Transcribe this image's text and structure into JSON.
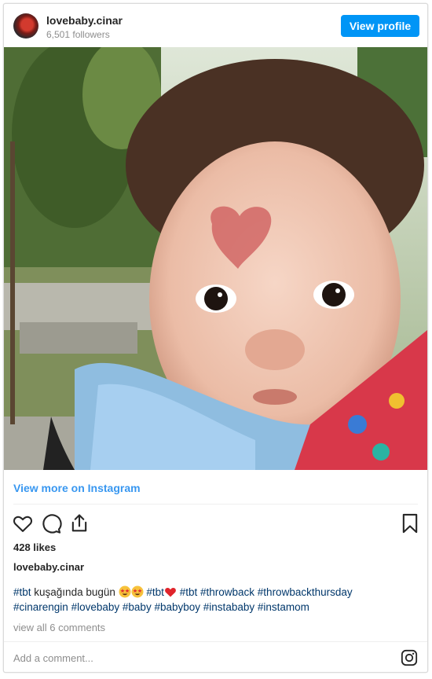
{
  "header": {
    "username": "lovebaby.cinar",
    "followers": "6,501 followers",
    "view_profile_label": "View profile"
  },
  "post": {
    "view_more_label": "View more on Instagram",
    "likes": "428 likes",
    "author": "lovebaby.cinar",
    "caption": {
      "line1_parts": [
        "#tbt",
        " kuşağında bugün ",
        "#tbt",
        " ",
        "#tbt",
        " ",
        "#throwback",
        " ",
        "#throwbackthursday"
      ],
      "line2": [
        "#cinarengin",
        "#lovebaby",
        "#baby",
        "#babyboy",
        "#instababy",
        "#instamom"
      ]
    },
    "view_comments_label": "view all 6 comments",
    "add_comment_placeholder": "Add a comment..."
  },
  "icons": {
    "like": "heart-icon",
    "comment": "comment-icon",
    "share": "share-icon",
    "save": "bookmark-icon",
    "instagram": "instagram-icon"
  },
  "colors": {
    "accent": "#0095f6",
    "link": "#3897f0",
    "hashtag": "#00376b",
    "muted": "#8e8e8e"
  }
}
